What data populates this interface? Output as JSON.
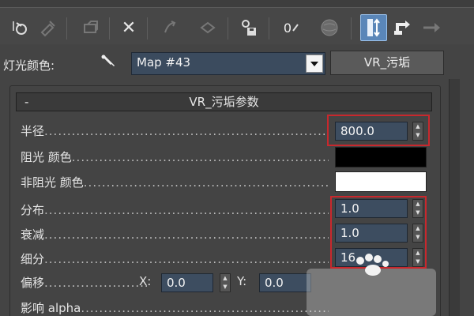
{
  "toolbar": {
    "icons": [
      "reset-map-icon",
      "put-material-icon",
      "assign-material-icon",
      "delete-icon",
      "make-unique-icon",
      "copy-material-icon",
      "save-library-icon",
      "material-id-icon",
      "sphere-preview-icon",
      "show-map-icon",
      "go-parent-icon",
      "go-forward-icon"
    ],
    "delete_glyph": "✕",
    "zero_glyph": "0"
  },
  "map_row": {
    "label": "灯光颜色:",
    "map_name": "Map #43",
    "map_type_button": "VR_污垢"
  },
  "rollout": {
    "minus": "-",
    "title": "VR_污垢参数"
  },
  "params": {
    "radius": {
      "label": "半径",
      "value": "800.0"
    },
    "occluded_color": {
      "label": "阻光 颜色",
      "color": "#000000"
    },
    "unoccluded_color": {
      "label": "非阻光 颜色",
      "color": "#ffffff"
    },
    "distribution": {
      "label": "分布",
      "value": "1.0"
    },
    "falloff": {
      "label": "衰减",
      "value": "1.0"
    },
    "subdivs": {
      "label": "细分",
      "value": "16"
    },
    "bias": {
      "label": "偏移",
      "x_label": "X:",
      "x_value": "0.0",
      "y_label": "Y:",
      "y_value": "0.0"
    },
    "affect_alpha": {
      "label": "影响 alpha"
    }
  },
  "colors": {
    "highlight": "#c8282d",
    "field_bg": "#3d4d60",
    "active_tool": "#5a86b8"
  }
}
